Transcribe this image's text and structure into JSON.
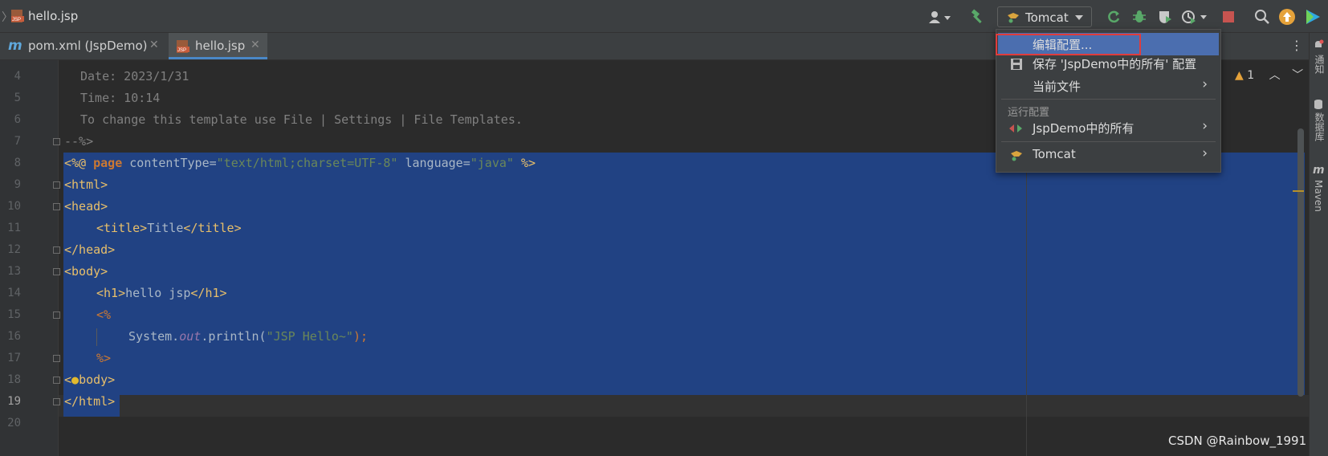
{
  "window": {
    "title": "hello.jsp"
  },
  "toolbar": {
    "run_config": "Tomcat"
  },
  "tabs": [
    {
      "label": "pom.xml (JspDemo)"
    },
    {
      "label": "hello.jsp"
    }
  ],
  "editor": {
    "line_numbers": [
      "4",
      "5",
      "6",
      "7",
      "8",
      "9",
      "10",
      "11",
      "12",
      "13",
      "14",
      "15",
      "16",
      "17",
      "18",
      "19",
      "20"
    ],
    "comment_lines": [
      "Date: 2023/1/31",
      "Time: 10:14",
      "To change this template use File | Settings | File Templates.",
      "--%>"
    ],
    "code": {
      "directive_open": "<%@ ",
      "directive_kw": "page",
      "attr1": " contentType=",
      "val1": "\"text/html;charset=UTF-8\"",
      "attr2": " language=",
      "val2": "\"java\"",
      "directive_close": " %>",
      "html_open": "<html>",
      "head_open": "<head>",
      "title_open": "<title>",
      "title_text": "Title",
      "title_close": "</title>",
      "head_close": "</head>",
      "body_open": "<body>",
      "h1_open": "<h1>",
      "h1_text": "hello jsp",
      "h1_close": "</h1>",
      "scriptlet_open": "<%",
      "sys": "System.",
      "out": "out",
      "println": ".println(",
      "println_arg": "\"JSP Hello~\"",
      "println_end": ");",
      "scriptlet_close": "%>",
      "body_close_a": "<",
      "body_close_b": "body>",
      "html_close": "</html>"
    },
    "warning_count": "1"
  },
  "run_menu": {
    "edit_config": "编辑配置...",
    "save_config": "保存 'JspDemo中的所有' 配置",
    "current_file": "当前文件",
    "section_label": "运行配置",
    "jspdemo_all": "JspDemo中的所有",
    "tomcat": "Tomcat"
  },
  "right_strip": {
    "notifications": "通知",
    "database": "数据库",
    "maven": "Maven"
  },
  "watermark": "CSDN @Rainbow_1991",
  "colors": {
    "accent": "#4b6eaf",
    "selection": "#214283",
    "highlight": "#e03c3c",
    "tag": "#e8bf6a"
  }
}
